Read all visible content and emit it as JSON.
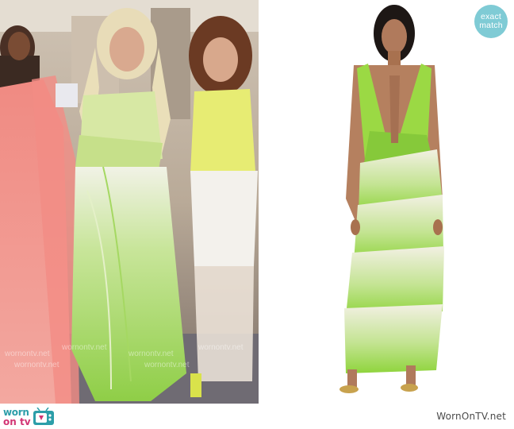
{
  "badge": {
    "line1": "exact",
    "line2": "match"
  },
  "watermark": "wornontv.net",
  "footer": {
    "logo_line1": "worn",
    "logo_line2": "on tv",
    "site": "WornOnTV.net"
  },
  "colors": {
    "badge": "#7fcbd5",
    "logo_teal": "#2c9ea9",
    "logo_pink": "#d23574",
    "dress_green": "#9bd944",
    "dress_cream": "#f2f0e3"
  }
}
